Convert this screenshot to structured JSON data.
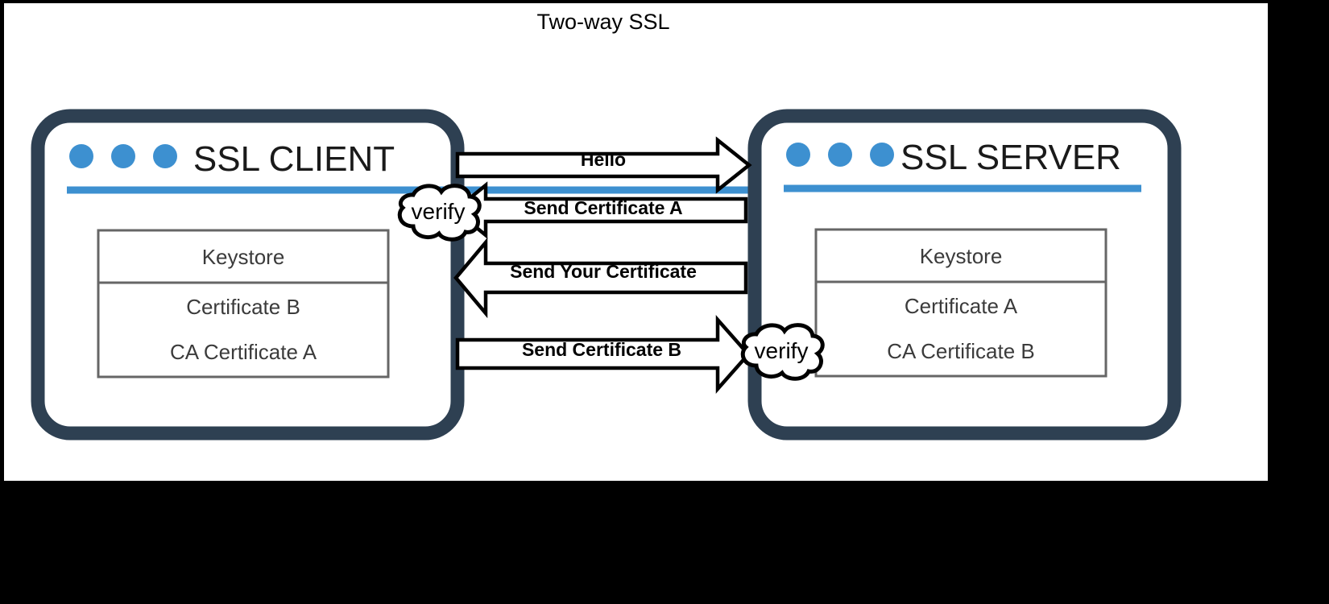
{
  "title": "Two-way SSL",
  "colors": {
    "window_border": "#2e4052",
    "accent_blue": "#3d90d0",
    "keystore_border": "#666666",
    "canvas_background": "#ffffff",
    "page_background": "#000000"
  },
  "client": {
    "header": "SSL CLIENT",
    "dots_icon": "three-dots-icon",
    "keystore": {
      "title": "Keystore",
      "entries": [
        "Certificate B",
        "CA Certificate A"
      ]
    },
    "verify_bubble": "verify"
  },
  "server": {
    "header": "SSL SERVER",
    "dots_icon": "three-dots-icon",
    "keystore": {
      "title": "Keystore",
      "entries": [
        "Certificate A",
        "CA Certificate B"
      ]
    },
    "verify_bubble": "verify"
  },
  "messages": [
    {
      "label": "Hello",
      "direction": "client-to-server"
    },
    {
      "label": "Send Certificate A",
      "direction": "server-to-client"
    },
    {
      "label": "Send Your Certificate",
      "direction": "server-to-client"
    },
    {
      "label": "Send Certificate B",
      "direction": "client-to-server"
    }
  ]
}
